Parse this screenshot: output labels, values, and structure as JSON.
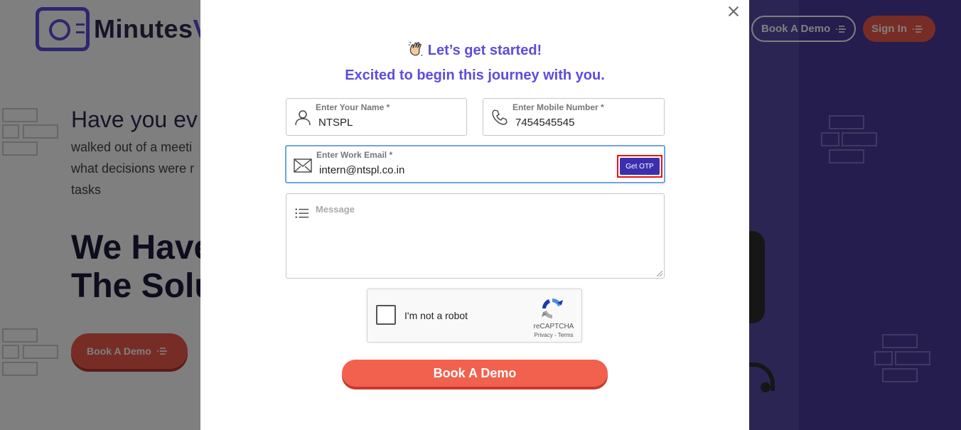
{
  "background": {
    "logo_text_dark": "Minutes",
    "logo_text_accent": "V",
    "hero_question": "Have you ev",
    "hero_paragraph": [
      "walked out of a meeti",
      "what decisions were r",
      "tasks"
    ],
    "hero_heading": [
      "We Have",
      "The Solu"
    ],
    "hero_button": "Book A Demo",
    "nav": {
      "book_demo": "Book A Demo",
      "sign_in": "Sign In"
    }
  },
  "modal": {
    "title": "Let’s get started!",
    "subtitle": "Excited to begin this journey with you.",
    "fields": {
      "name": {
        "label": "Enter Your Name *",
        "value": "NTSPL",
        "icon": "user-icon"
      },
      "mobile": {
        "label": "Enter Mobile Number *",
        "value": "7454545545",
        "icon": "phone-icon"
      },
      "email": {
        "label": "Enter Work Email *",
        "value": "intern@ntspl.co.in",
        "icon": "envelope-icon"
      },
      "message": {
        "placeholder": "Message",
        "icon": "list-icon"
      }
    },
    "otp_button": "Get OTP",
    "captcha": {
      "label": "I'm not a robot",
      "brand": "reCAPTCHA",
      "links": "Privacy - Terms"
    },
    "submit": "Book A Demo"
  },
  "colors": {
    "accent": "#5b4de0",
    "cta": "#f2614e",
    "otp_bg": "#3c2fae",
    "highlight_border": "#ee1111",
    "bg_right": "#4a3a9c"
  }
}
